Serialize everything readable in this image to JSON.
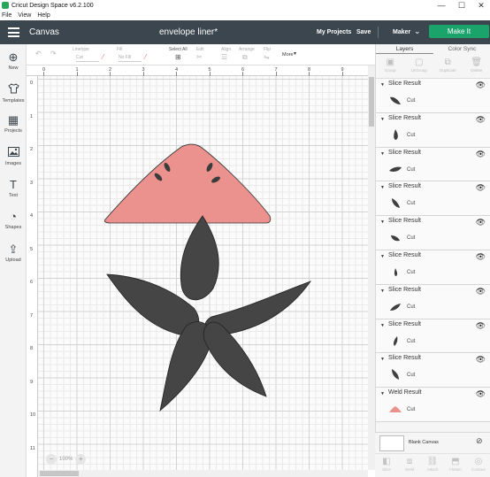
{
  "window": {
    "title": "Cricut Design Space  v6.2.100",
    "minimize": "—",
    "maximize": "☐",
    "close": "✕"
  },
  "menu": [
    "File",
    "View",
    "Help"
  ],
  "header": {
    "canvas_label": "Canvas",
    "document_title": "envelope liner*",
    "my_projects": "My Projects",
    "save": "Save",
    "machine": "Maker",
    "make_it": "Make It"
  },
  "edit_toolbar": {
    "linetype_label": "Linetype",
    "linetype_value": "Cut",
    "fill_label": "Fill",
    "fill_value": "No Fill",
    "select_all": "Select All",
    "edit": "Edit",
    "align": "Align",
    "arrange": "Arrange",
    "flip": "Flip",
    "more": "More"
  },
  "sidebar": {
    "items": [
      {
        "label": "New",
        "icon": "plus-icon",
        "glyph": "⊕"
      },
      {
        "label": "Templates",
        "icon": "shirt-icon",
        "glyph": "👕"
      },
      {
        "label": "Projects",
        "icon": "projects-icon",
        "glyph": "▦"
      },
      {
        "label": "Images",
        "icon": "image-icon",
        "glyph": "🖼"
      },
      {
        "label": "Text",
        "icon": "text-icon",
        "glyph": "T"
      },
      {
        "label": "Shapes",
        "icon": "shapes-icon",
        "glyph": "◔"
      },
      {
        "label": "Upload",
        "icon": "upload-icon",
        "glyph": "⇪"
      }
    ]
  },
  "rulers": {
    "horizontal": [
      "0",
      "1",
      "2",
      "3",
      "4",
      "5",
      "6",
      "7",
      "8",
      "9",
      "10"
    ],
    "vertical": [
      "0",
      "1",
      "2",
      "3",
      "4",
      "5",
      "6",
      "7",
      "8",
      "9",
      "10",
      "11"
    ]
  },
  "zoom": {
    "minus": "−",
    "level": "100%",
    "plus": "+"
  },
  "panel": {
    "tabs": [
      "Layers",
      "Color Sync"
    ],
    "tools": [
      {
        "label": "Group",
        "icon": "group-icon",
        "glyph": "▣"
      },
      {
        "label": "UnGroup",
        "icon": "ungroup-icon",
        "glyph": "▢"
      },
      {
        "label": "Duplicate",
        "icon": "duplicate-icon",
        "glyph": "⧉"
      },
      {
        "label": "Delete",
        "icon": "trash-icon",
        "glyph": "🗑"
      }
    ],
    "layers": [
      {
        "name": "Slice Result",
        "op": "Cut",
        "thumb": "leaf-a",
        "color": "#3f3f3f"
      },
      {
        "name": "Slice Result",
        "op": "Cut",
        "thumb": "drop",
        "color": "#3f3f3f"
      },
      {
        "name": "Slice Result",
        "op": "Cut",
        "thumb": "leaf-b",
        "color": "#3f3f3f"
      },
      {
        "name": "Slice Result",
        "op": "Cut",
        "thumb": "leaf-c",
        "color": "#3f3f3f"
      },
      {
        "name": "Slice Result",
        "op": "Cut",
        "thumb": "leaf-d",
        "color": "#3f3f3f"
      },
      {
        "name": "Slice Result",
        "op": "Cut",
        "thumb": "drop-small",
        "color": "#3f3f3f"
      },
      {
        "name": "Slice Result",
        "op": "Cut",
        "thumb": "leaf-e",
        "color": "#3f3f3f"
      },
      {
        "name": "Slice Result",
        "op": "Cut",
        "thumb": "drop-b",
        "color": "#3f3f3f"
      },
      {
        "name": "Slice Result",
        "op": "Cut",
        "thumb": "leaf-f",
        "color": "#3f3f3f"
      },
      {
        "name": "Weld Result",
        "op": "Cut",
        "thumb": "cone",
        "color": "#eb928f"
      }
    ],
    "blank_canvas": "Blank Canvas",
    "bottom_tools": [
      {
        "label": "Slice",
        "icon": "slice-icon",
        "glyph": "◧"
      },
      {
        "label": "Weld",
        "icon": "weld-icon",
        "glyph": "⧈"
      },
      {
        "label": "Attach",
        "icon": "attach-icon",
        "glyph": "⛓"
      },
      {
        "label": "Flatten",
        "icon": "flatten-icon",
        "glyph": "⬒"
      },
      {
        "label": "Contour",
        "icon": "contour-icon",
        "glyph": "◎"
      }
    ]
  },
  "colors": {
    "header_bg": "#3c464e",
    "make_it": "#1aa36a",
    "pink_shape": "#eb928f",
    "dark_shape": "#454545"
  }
}
